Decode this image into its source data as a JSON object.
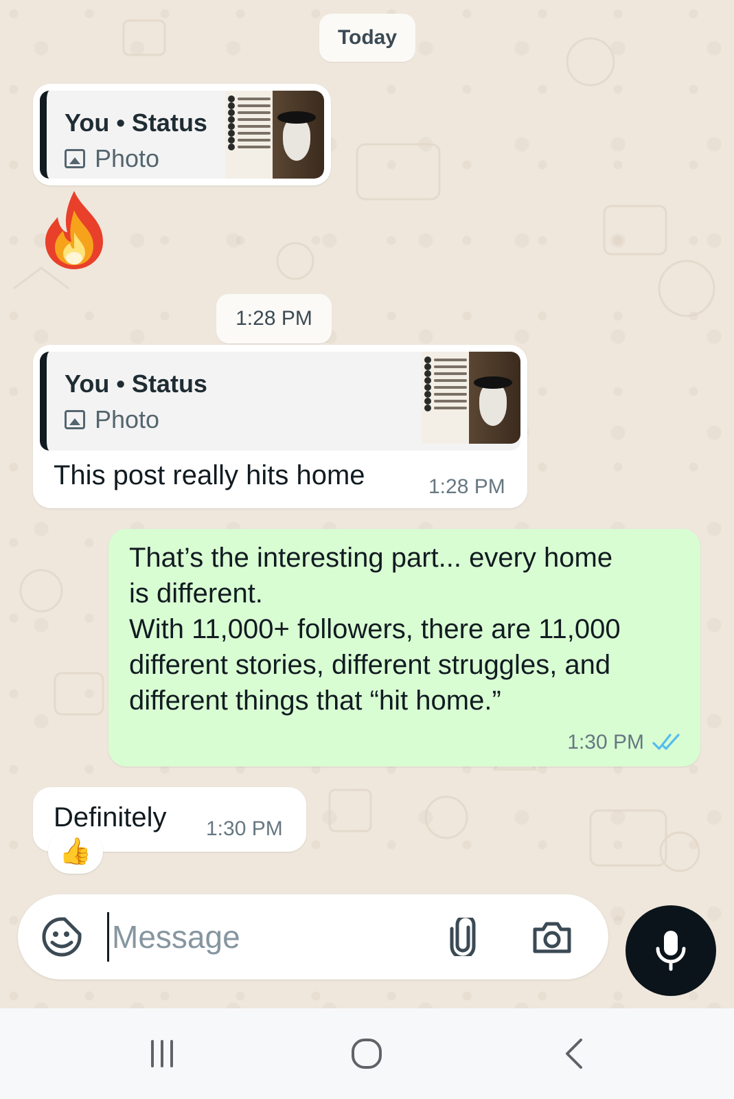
{
  "date_separator": "Today",
  "time_separator": "1:28 PM",
  "messages": [
    {
      "type": "status_reply",
      "quote_title": "You • Status",
      "quote_sub": "Photo",
      "reaction": "fire"
    },
    {
      "type": "incoming",
      "quote_title": "You • Status",
      "quote_sub": "Photo",
      "text": "This post really hits home",
      "time": "1:28 PM"
    },
    {
      "type": "outgoing",
      "lines": [
        "That’s the interesting part... every home",
        "is different.",
        "With 11,000+ followers, there are 11,000",
        "different stories, different struggles, and",
        "different things that “hit home.”"
      ],
      "time": "1:30 PM",
      "status": "read"
    },
    {
      "type": "incoming",
      "text": "Definitely",
      "time": "1:30 PM",
      "reaction": "👍"
    }
  ],
  "input": {
    "placeholder": "Message"
  },
  "icons": {
    "emoji": "sticker-smiley-icon",
    "attach": "paperclip-icon",
    "camera": "camera-icon",
    "mic": "microphone-icon",
    "nav_recents": "recent-apps-icon",
    "nav_home": "home-icon",
    "nav_back": "back-icon"
  },
  "colors": {
    "chat_background": "#efe7dc",
    "incoming_bubble": "#ffffff",
    "outgoing_bubble": "#d9fdd3",
    "read_ticks": "#53bdeb",
    "mic_button": "#0b141a"
  }
}
